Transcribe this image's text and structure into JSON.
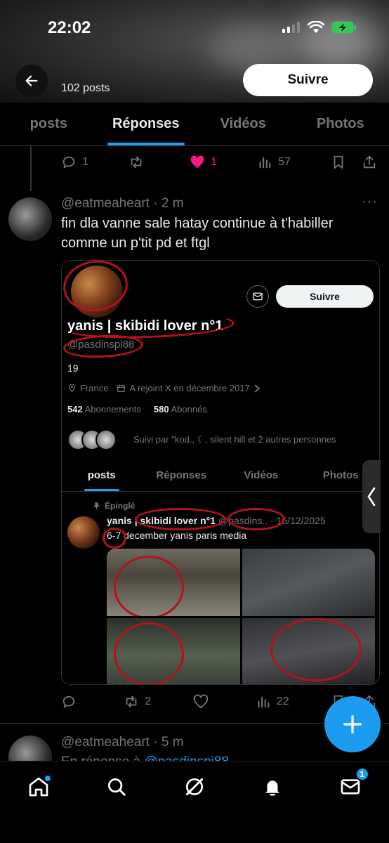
{
  "status_bar": {
    "time": "22:02"
  },
  "header": {
    "post_count": "102 posts",
    "follow_label": "Suivre"
  },
  "tabs": [
    {
      "label": "posts",
      "active": false
    },
    {
      "label": "Réponses",
      "active": true
    },
    {
      "label": "Vidéos",
      "active": false
    },
    {
      "label": "Photos",
      "active": false
    }
  ],
  "first_actions": {
    "replies": "1",
    "retweets": "",
    "likes": "1",
    "views": "57"
  },
  "tweet1": {
    "handle_time": "@eatmeaheart · 2 m",
    "text": "fin dla vanne sale hatay continue à t'habiller comme un p'tit pd et ftgl",
    "more": "···",
    "actions": {
      "replies": "",
      "retweets": "2",
      "likes": "",
      "views": "22"
    }
  },
  "embedded": {
    "follow_label": "Suivre",
    "name": "yanis | skibidi lover n°1",
    "handle": "@pasdinspi88",
    "bio": "19",
    "location": "France",
    "joined": "A rejoint X en décembre 2017",
    "following_count": "542",
    "following_label": "Abonnements",
    "followers_count": "580",
    "followers_label": "Abonnés",
    "followed_by": "Suivi par \"kod., ☾, silent hill et 2 autres personnes",
    "tabs": [
      "posts",
      "Réponses",
      "Vidéos",
      "Photos"
    ],
    "pinned_label": "Épinglé",
    "inner_name": "yanis | skibidi lover n°1",
    "inner_meta": "@pasdins.. · 15/12/2025",
    "inner_text": "6-7 december yanis paris media"
  },
  "tweet2": {
    "handle_time": "@eatmeaheart · 5 m",
    "reply_prefix": "En réponse à",
    "reply_to": "@pasdinspi88"
  },
  "bottom_nav": {
    "messages_badge": "1"
  },
  "colors": {
    "accent": "#1d9bf0",
    "like": "#f91880",
    "annotation_red": "#b3121a"
  }
}
